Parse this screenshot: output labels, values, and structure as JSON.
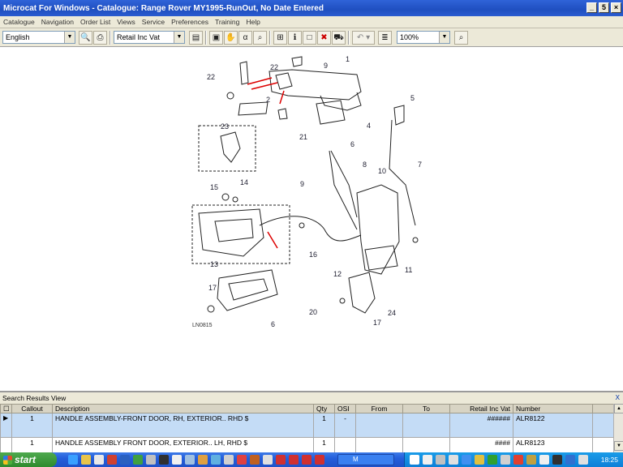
{
  "window": {
    "title": "Microcat For Windows - Catalogue: Range Rover MY1995-RunOut, No Date Entered",
    "minimize": "_",
    "maximize": "5",
    "close": "×"
  },
  "menu": [
    "Catalogue",
    "Navigation",
    "Order List",
    "Views",
    "Service",
    "Preferences",
    "Training",
    "Help"
  ],
  "toolbar": {
    "language": "English",
    "price_mode": "Retail Inc Vat",
    "zoom": "100%"
  },
  "diagram": {
    "callouts": [
      "22",
      "22",
      "9",
      "1",
      "2",
      "3",
      "4",
      "5",
      "21",
      "6",
      "23",
      "8",
      "7",
      "9",
      "10",
      "14",
      "15",
      "16",
      "12",
      "11",
      "13",
      "17",
      "6",
      "20",
      "24",
      "17"
    ],
    "code": "LN0815"
  },
  "results": {
    "title": "Search Results View",
    "close": "X",
    "columns": [
      "Callout",
      "Description",
      "Qty",
      "OSI",
      "From",
      "To",
      "Retail Inc Vat",
      "Number"
    ],
    "rows": [
      {
        "callout": "1",
        "description": "HANDLE ASSEMBLY-FRONT DOOR, RH, EXTERIOR.. RHD $",
        "qty": "1",
        "osi": "-",
        "from": "",
        "to": "",
        "price": "######",
        "number": "ALR8122"
      },
      {
        "callout": "1",
        "description": "HANDLE ASSEMBLY FRONT DOOR, EXTERIOR.. LH, RHD $",
        "qty": "1",
        "osi": "",
        "from": "",
        "to": "",
        "price": "####",
        "number": "ALR8123"
      }
    ]
  },
  "taskbar": {
    "start": "start",
    "task_label": "M",
    "clock": "18:25"
  }
}
